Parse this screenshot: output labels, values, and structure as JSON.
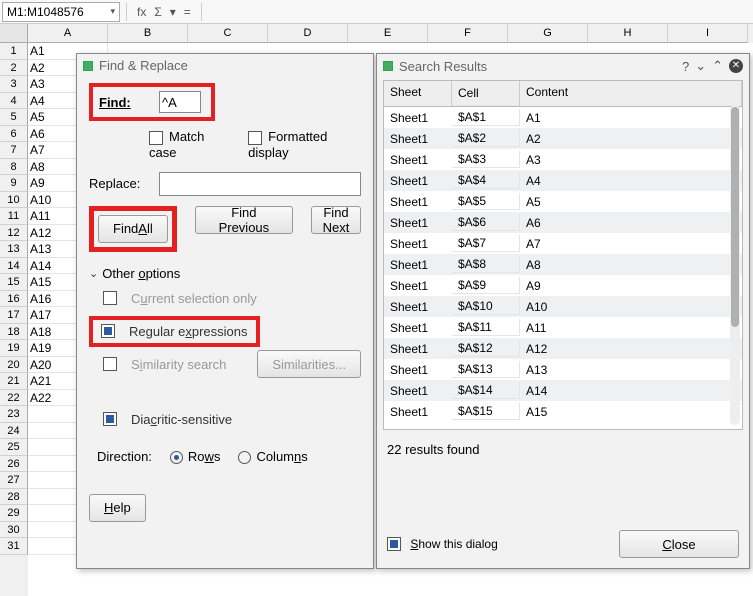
{
  "name_box": "M1:M1048576",
  "formula_symbols": {
    "fx": "fx",
    "sigma": "Σ",
    "dash": "▾",
    "eq": "="
  },
  "columns": [
    "A",
    "B",
    "C",
    "D",
    "E",
    "F",
    "G",
    "H",
    "I"
  ],
  "row_nums": [
    1,
    2,
    3,
    4,
    5,
    6,
    7,
    8,
    9,
    10,
    11,
    12,
    13,
    14,
    15,
    16,
    17,
    18,
    19,
    20,
    21,
    22,
    23,
    24,
    25,
    26,
    27,
    28,
    29,
    30,
    31
  ],
  "col_a_values": [
    "A1",
    "A2",
    "A3",
    "A4",
    "A5",
    "A6",
    "A7",
    "A8",
    "A9",
    "A10",
    "A11",
    "A12",
    "A13",
    "A14",
    "A15",
    "A16",
    "A17",
    "A18",
    "A19",
    "A20",
    "A21",
    "A22"
  ],
  "find_replace": {
    "title": "Find & Replace",
    "find_label": "Find:",
    "find_value": "^A",
    "match_case": "Match case",
    "formatted_display": "Formatted display",
    "replace_label": "Replace:",
    "replace_value": "",
    "find_all": "Find All",
    "find_previous": "Find Previous",
    "find_next": "Find Next",
    "other_options": "Other options",
    "opt_current_selection": "Current selection only",
    "opt_regex": "Regular expressions",
    "opt_similarity": "Similarity search",
    "similarities_btn": "Similarities...",
    "opt_diacritic": "Diacritic-sensitive",
    "direction_label": "Direction:",
    "dir_rows": "Rows",
    "dir_columns": "Columns",
    "help": "Help"
  },
  "search_results": {
    "title": "Search Results",
    "col_sheet": "Sheet",
    "col_cell": "Cell",
    "col_content": "Content",
    "rows": [
      {
        "sheet": "Sheet1",
        "cell": "$A$1",
        "content": "A1"
      },
      {
        "sheet": "Sheet1",
        "cell": "$A$2",
        "content": "A2"
      },
      {
        "sheet": "Sheet1",
        "cell": "$A$3",
        "content": "A3"
      },
      {
        "sheet": "Sheet1",
        "cell": "$A$4",
        "content": "A4"
      },
      {
        "sheet": "Sheet1",
        "cell": "$A$5",
        "content": "A5"
      },
      {
        "sheet": "Sheet1",
        "cell": "$A$6",
        "content": "A6"
      },
      {
        "sheet": "Sheet1",
        "cell": "$A$7",
        "content": "A7"
      },
      {
        "sheet": "Sheet1",
        "cell": "$A$8",
        "content": "A8"
      },
      {
        "sheet": "Sheet1",
        "cell": "$A$9",
        "content": "A9"
      },
      {
        "sheet": "Sheet1",
        "cell": "$A$10",
        "content": "A10"
      },
      {
        "sheet": "Sheet1",
        "cell": "$A$11",
        "content": "A11"
      },
      {
        "sheet": "Sheet1",
        "cell": "$A$12",
        "content": "A12"
      },
      {
        "sheet": "Sheet1",
        "cell": "$A$13",
        "content": "A13"
      },
      {
        "sheet": "Sheet1",
        "cell": "$A$14",
        "content": "A14"
      },
      {
        "sheet": "Sheet1",
        "cell": "$A$15",
        "content": "A15"
      }
    ],
    "count_text": "22 results found",
    "show_dialog": "Show this dialog",
    "close": "Close"
  }
}
